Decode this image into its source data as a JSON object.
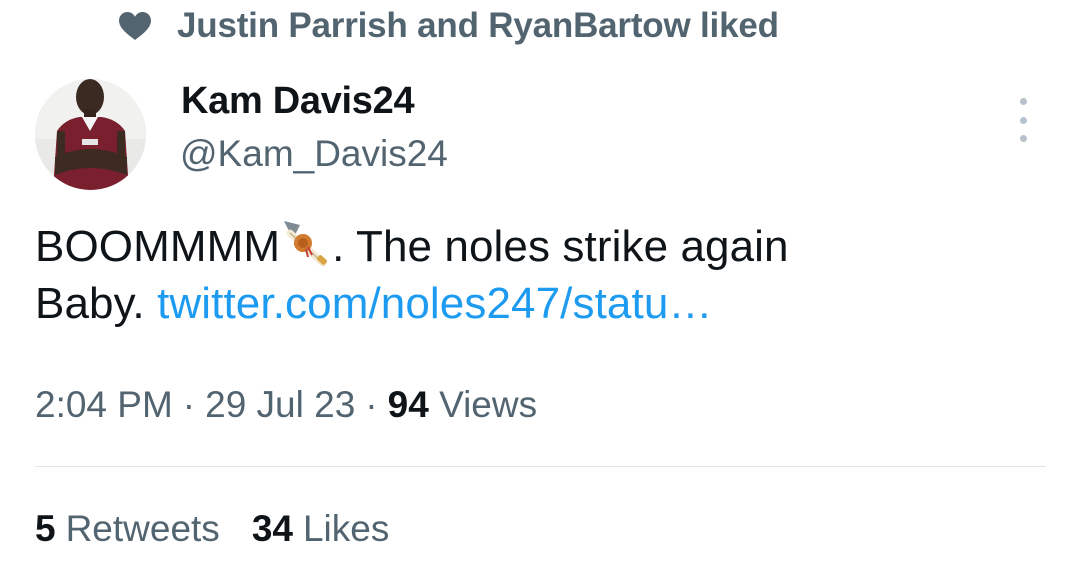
{
  "social_context": {
    "icon": "heart-icon",
    "text": "Justin Parrish and RyanBartow liked"
  },
  "author": {
    "display_name": "Kam Davis24",
    "handle": "@Kam_Davis24",
    "avatar_alt": "Kam Davis24"
  },
  "tweet": {
    "text_before_emoji": "BOOMMMM",
    "emoji": "tomahawk-emoji",
    "text_after_emoji": ". The noles strike again",
    "line2_text": "Baby. ",
    "link_text": "twitter.com/noles247/statu…"
  },
  "meta": {
    "time": "2:04 PM",
    "separator": "·",
    "date": "29 Jul 23",
    "views_count": "94",
    "views_label": "Views"
  },
  "stats": {
    "retweets_count": "5",
    "retweets_label": "Retweets",
    "likes_count": "34",
    "likes_label": "Likes"
  },
  "colors": {
    "text_primary": "#0f1419",
    "text_secondary": "#536471",
    "link": "#1d9bf0",
    "divider": "#e1e6ea"
  }
}
